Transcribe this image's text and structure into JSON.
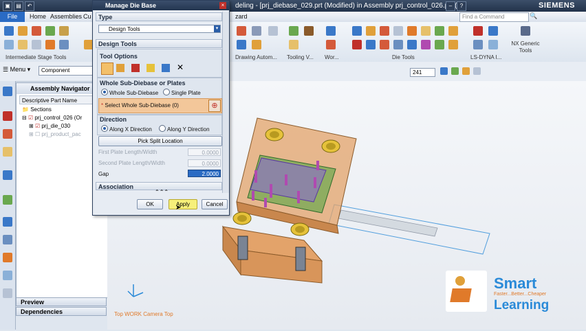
{
  "titlebar": {
    "title": "deling - [prj_diebase_029.prt (Modified)  in Assembly prj_control_026.prt  (!)]",
    "brand": "SIEMENS"
  },
  "menubar": {
    "file": "File",
    "home": "Home",
    "assemblies": "Assemblies",
    "cut_tab": "Cu",
    "wizard": "zard",
    "find_placeholder": "Find a Command"
  },
  "ribbon": {
    "groups": {
      "intermediate": "Intermediate Stage Tools",
      "drawing": "Drawing Autom...",
      "tooling": "Tooling V...",
      "wor": "Wor...",
      "die_tools": "Die Tools",
      "lsdyna": "LS-DYNA I...",
      "nx_generic": "NX Generic Tools"
    }
  },
  "toolbar": {
    "menu": "Menu",
    "component": "Component",
    "zoom": "241"
  },
  "navigator": {
    "title": "Assembly Navigator",
    "column": "Descriptive Part Name",
    "items": [
      "Sections",
      "prj_control_026 (Or",
      "prj_die_030",
      "prj_product_pac"
    ]
  },
  "panels": {
    "preview": "Preview",
    "dependencies": "Dependencies"
  },
  "graphics": {
    "view_label": "Top WORK Camera Top"
  },
  "dialog": {
    "title": "Manage Die Base",
    "type_section": "Type",
    "type_value": "Design Tools",
    "design_section": "Design Tools",
    "tool_options": "Tool Options",
    "whole_plates_title": "Whole Sub-Diebase or Plates",
    "whole_sub_diebase": "Whole Sub-Diebase",
    "single_plate": "Single Plate",
    "select_whole": "Select Whole Sub-Diebase (0)",
    "direction_title": "Direction",
    "along_x": "Along X Direction",
    "along_y": "Along Y Direction",
    "pick_split": "Pick Split Location",
    "first_plate_label": "First Plate Length/Width",
    "first_plate_value": "0.0000",
    "second_plate_label": "Second Plate Length/Width",
    "second_plate_value": "0.0000",
    "gap_label": "Gap",
    "gap_value": "2.0000",
    "association": "Association",
    "ok": "OK",
    "apply": "Apply",
    "cancel": "Cancel"
  },
  "logo": {
    "brand_top": "Smart",
    "tagline": "Faster...Better...Cheaper",
    "brand_bottom": "Learning"
  },
  "colors": {
    "titlebar": "#22324a",
    "file_tab": "#2a6bc4",
    "accent_orange": "#e07a2a",
    "die_orange": "#e3a36a",
    "logo_blue": "#2a8ad8"
  }
}
